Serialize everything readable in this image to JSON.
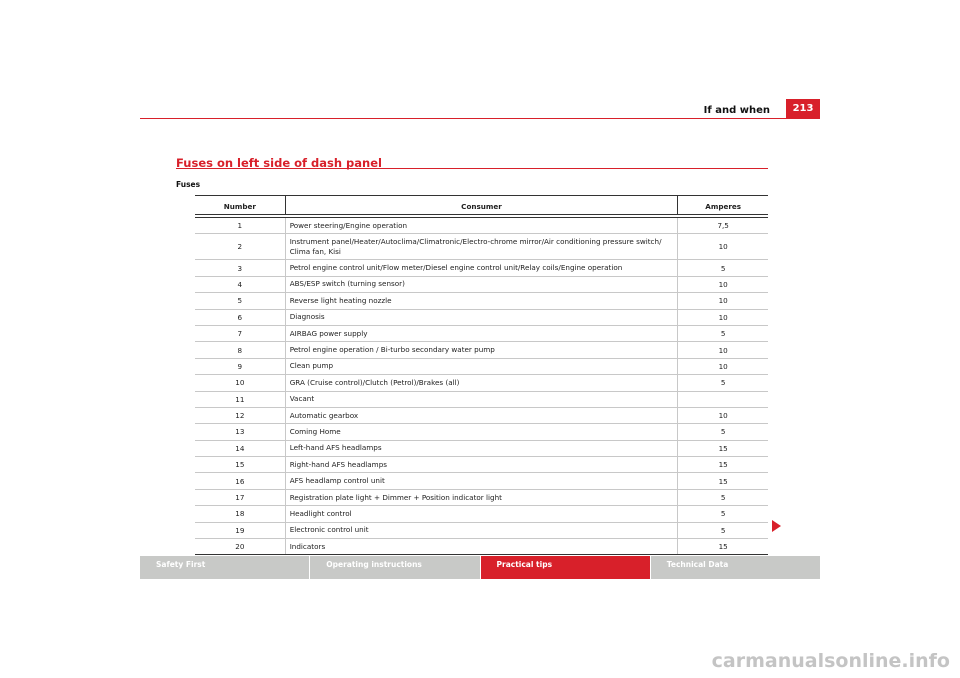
{
  "header": {
    "title": "If and when",
    "page_number": "213"
  },
  "section": {
    "title": "Fuses on left side of dash panel",
    "subtitle": "Fuses"
  },
  "table": {
    "headers": {
      "number": "Number",
      "consumer": "Consumer",
      "amperes": "Amperes"
    },
    "rows": [
      {
        "number": "1",
        "consumer": "Power steering/Engine operation",
        "amperes": "7,5"
      },
      {
        "number": "2",
        "consumer": "Instrument panel/Heater/Autoclima/Climatronic/Electro-chrome mirror/Air conditioning pressure switch/ Clima fan, Kisi",
        "amperes": "10"
      },
      {
        "number": "3",
        "consumer": "Petrol engine control unit/Flow meter/Diesel engine control unit/Relay coils/Engine operation",
        "amperes": "5"
      },
      {
        "number": "4",
        "consumer": "ABS/ESP switch (turning sensor)",
        "amperes": "10"
      },
      {
        "number": "5",
        "consumer": "Reverse light heating nozzle",
        "amperes": "10"
      },
      {
        "number": "6",
        "consumer": "Diagnosis",
        "amperes": "10"
      },
      {
        "number": "7",
        "consumer": "AIRBAG power supply",
        "amperes": "5"
      },
      {
        "number": "8",
        "consumer": "Petrol engine operation / Bi-turbo secondary water pump",
        "amperes": "10"
      },
      {
        "number": "9",
        "consumer": "Clean pump",
        "amperes": "10"
      },
      {
        "number": "10",
        "consumer": "GRA (Cruise control)/Clutch (Petrol)/Brakes (all)",
        "amperes": "5"
      },
      {
        "number": "11",
        "consumer": "Vacant",
        "amperes": ""
      },
      {
        "number": "12",
        "consumer": "Automatic gearbox",
        "amperes": "10"
      },
      {
        "number": "13",
        "consumer": "Coming Home",
        "amperes": "5"
      },
      {
        "number": "14",
        "consumer": "Left-hand AFS headlamps",
        "amperes": "15"
      },
      {
        "number": "15",
        "consumer": "Right-hand AFS headlamps",
        "amperes": "15"
      },
      {
        "number": "16",
        "consumer": "AFS headlamp control unit",
        "amperes": "15"
      },
      {
        "number": "17",
        "consumer": "Registration plate light + Dimmer + Position indicator light",
        "amperes": "5"
      },
      {
        "number": "18",
        "consumer": "Headlight control",
        "amperes": "5"
      },
      {
        "number": "19",
        "consumer": "Electronic control unit",
        "amperes": "5"
      },
      {
        "number": "20",
        "consumer": "Indicators",
        "amperes": "15"
      }
    ]
  },
  "footer": {
    "tabs": [
      {
        "label": "Safety First"
      },
      {
        "label": "Operating instructions"
      },
      {
        "label": "Practical tips",
        "active": true
      },
      {
        "label": "Technical Data"
      }
    ]
  },
  "watermark": "carmanualsonline.info",
  "colors": {
    "accent": "#d8202a",
    "footer_inactive": "#c8c9c7"
  },
  "icons": {
    "next_page": "triangle-right-icon"
  }
}
